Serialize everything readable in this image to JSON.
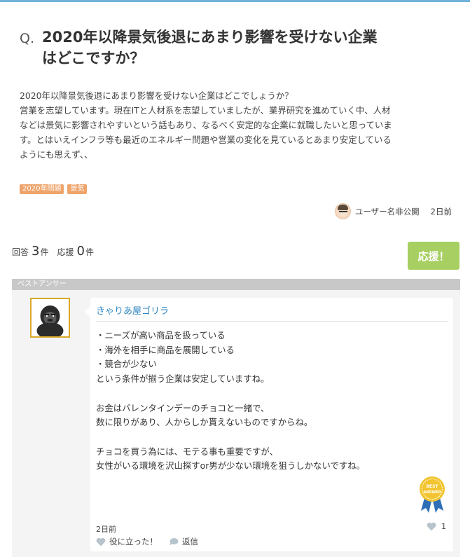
{
  "question": {
    "mark": "Q.",
    "title_lines": [
      "2020年以降景気後退にあまり影響を受けない企業",
      "はどこですか？"
    ],
    "body_lines": [
      "2020年以降景気後退にあまり影響を受けない企業はどこでしょうか？",
      "営業を志望しています。現在ITと人材系を志望していましたが、業界研究を進めていく中、人材",
      "などは景気に影響されやすいという話もあり、なるべく安定的な企業に就職したいと思っていま",
      "す。とはいえインフラ等も最近のエネルギー問題や営業の変化を見ているとあまり安定している",
      "ようにも思えず、、"
    ],
    "tags": [
      "2020年問題",
      "景気"
    ],
    "asker_name": "ユーザー名非公開",
    "asker_time": "2日前"
  },
  "stats": {
    "answers_label": "回答",
    "answers_count": "3",
    "answers_unit": "件",
    "cheers_label": "応援",
    "cheers_count": "0",
    "cheers_unit": "件",
    "cheer_button": "応援！"
  },
  "best_answer": {
    "section_label": "ベストアンサー",
    "answerer_name": "きゃりあ屋ゴリラ",
    "text_lines": [
      "・ニーズが高い商品を扱っている",
      "・海外を相手に商品を展開している",
      "・競合が少ない",
      "という条件が揃う企業は安定していますね。",
      "",
      "お金はバレンタインデーのチョコと一緒で、",
      "数に限りがあり、人からしか貰えないものですからね。",
      "",
      "チョコを買う為には、モテる事も重要ですが、",
      "女性がいる環境を沢山探すor男が少ない環境を狙うしかないですね。"
    ],
    "badge_text_top": "BEST",
    "badge_text_bottom": "ANSWER",
    "time": "2日前",
    "like_count": "1",
    "helpful_label": "役に立った！",
    "reply_label": "返信"
  },
  "colors": {
    "accent_blue": "#2e87c0",
    "tag_orange": "#efa46b",
    "cheer_green": "#a7cf62",
    "badge_gold": "#f2c530",
    "badge_ribbon": "#2f6fb8"
  },
  "icons": {
    "asker": "user-avatar-icon",
    "answerer": "gorilla-avatar-icon",
    "badge": "best-answer-badge-icon",
    "like": "heart-icon",
    "reply": "speech-bubble-icon"
  }
}
